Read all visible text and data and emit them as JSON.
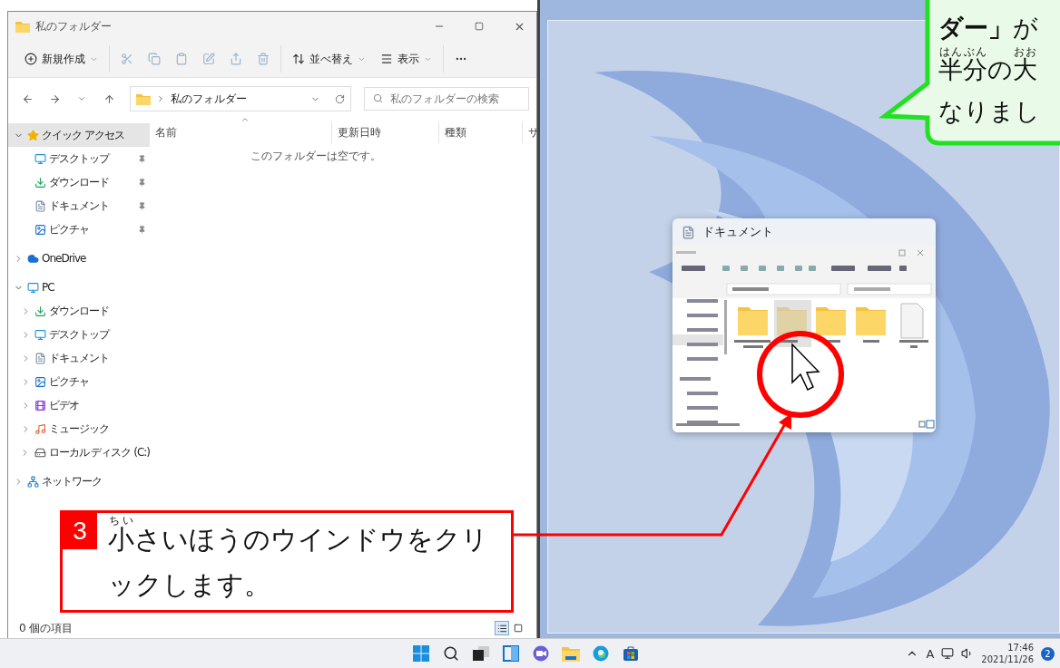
{
  "explorer": {
    "title": "私のフォルダー",
    "toolbar_groups": [
      [
        {
          "label": "新規作成",
          "dropdown": true,
          "disabled": false
        }
      ],
      [
        {
          "disabled": true
        },
        {
          "disabled": true
        },
        {
          "disabled": true
        },
        {
          "disabled": true
        },
        {
          "disabled": true
        },
        {
          "disabled": true
        }
      ],
      [
        {
          "label": "並べ替え",
          "dropdown": true,
          "disabled": false
        },
        {
          "label": "表示",
          "dropdown": true,
          "disabled": false
        }
      ],
      [
        {
          "disabled": false
        }
      ]
    ],
    "address": {
      "path": "私のフォルダー"
    },
    "search": {
      "placeholder": "私のフォルダーの検索"
    },
    "columns": [
      {
        "label": "名前",
        "sorted": true
      },
      {
        "label": "更新日時"
      },
      {
        "label": "種類"
      },
      {
        "label": "サ"
      }
    ],
    "empty_message": "このフォルダーは空です。",
    "sidebar": [
      {
        "label": "クイック アクセス",
        "expanded": true,
        "selected": true,
        "children": [
          {
            "label": "デスクトップ",
            "pinned": true,
            "selected": false
          },
          {
            "label": "ダウンロード",
            "pinned": true,
            "selected": false
          },
          {
            "label": "ドキュメント",
            "pinned": true,
            "selected": false
          },
          {
            "label": "ピクチャ",
            "pinned": true,
            "selected": false
          }
        ]
      },
      {
        "label": "OneDrive",
        "expanded": false,
        "selected": false
      },
      {
        "label": "PC",
        "expanded": true,
        "selected": false,
        "children": [
          {
            "label": "ダウンロード",
            "expanded": false,
            "selected": false
          },
          {
            "label": "デスクトップ",
            "expanded": false,
            "selected": false
          },
          {
            "label": "ドキュメント",
            "expanded": false,
            "selected": false
          },
          {
            "label": "ピクチャ",
            "expanded": false,
            "selected": false
          },
          {
            "label": "ビデオ",
            "expanded": false,
            "selected": false
          },
          {
            "label": "ミュージック",
            "expanded": false,
            "selected": false
          },
          {
            "label": "ローカル ディスク (C:)",
            "expanded": false,
            "selected": false
          }
        ]
      },
      {
        "label": "ネットワーク",
        "expanded": false,
        "selected": false
      }
    ],
    "status": "0 個の項目",
    "views": [
      {
        "selected": true
      },
      {
        "selected": false
      }
    ]
  },
  "thumbnail": {
    "title": "ドキュメント"
  },
  "step_callout": {
    "number": "3",
    "segments": [
      {
        "base": "小",
        "ruby": "ちい"
      },
      {
        "text": "さいほうのウインドウをクリックします。"
      }
    ]
  },
  "speech_bubble": {
    "lines": [
      [
        {
          "text": "**ダー」**が"
        }
      ],
      [
        {
          "base": "半分",
          "ruby": "はんぶん"
        },
        {
          "text": "の"
        },
        {
          "base": "大",
          "ruby": "おお"
        }
      ],
      [
        {
          "text": "なりまし"
        }
      ]
    ]
  },
  "taskbar": {
    "ime": "A",
    "time": "17:46",
    "date": "2021/11/26",
    "badge": "2"
  }
}
